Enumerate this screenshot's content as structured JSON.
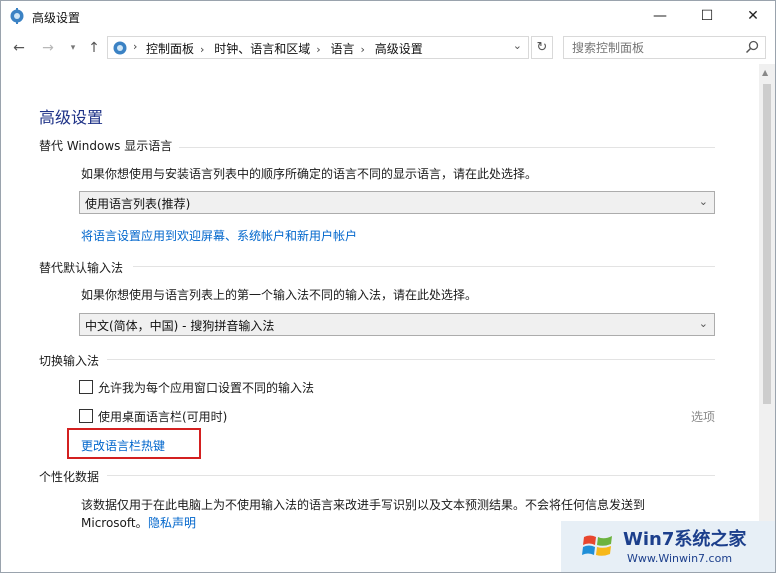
{
  "window": {
    "title": "高级设置",
    "min_glyph": "—",
    "max_glyph": "☐",
    "close_glyph": "✕"
  },
  "nav": {
    "back_glyph": "←",
    "fwd_glyph": "→",
    "drop_glyph": "▾",
    "up_glyph": "↑",
    "refresh_glyph": "↻",
    "address_dropdown_glyph": "⌄",
    "breadcrumb": [
      "控制面板",
      "时钟、语言和区域",
      "语言",
      "高级设置"
    ],
    "search_placeholder": "搜索控制面板"
  },
  "page": {
    "heading": "高级设置",
    "display_language": {
      "title": "替代 Windows 显示语言",
      "desc": "如果你想使用与安装语言列表中的顺序所确定的语言不同的显示语言，请在此处选择。",
      "select_value": "使用语言列表(推荐)",
      "link": "将语言设置应用到欢迎屏幕、系统帐户和新用户帐户"
    },
    "input_method": {
      "title": "替代默认输入法",
      "desc": "如果你想使用与语言列表上的第一个输入法不同的输入法，请在此处选择。",
      "select_value": "中文(简体，中国) - 搜狗拼音输入法"
    },
    "switch_input": {
      "title": "切换输入法",
      "checkbox1": "允许我为每个应用窗口设置不同的输入法",
      "checkbox2": "使用桌面语言栏(可用时)",
      "options_link": "选项",
      "hotkey_link": "更改语言栏热键"
    },
    "personalization": {
      "title": "个性化数据",
      "desc": "该数据仅用于在此电脑上为不使用输入法的语言来改进手写识别以及文本预测结果。不会将任何信息发送到",
      "desc2": "Microsoft。",
      "privacy_link": "隐私声明"
    }
  },
  "watermark": {
    "brand": "Win7系统之家",
    "url": "Www.Winwin7.com"
  },
  "colors": {
    "heading": "#1e3287",
    "link": "#0066cc",
    "highlight_border": "#d32020"
  }
}
